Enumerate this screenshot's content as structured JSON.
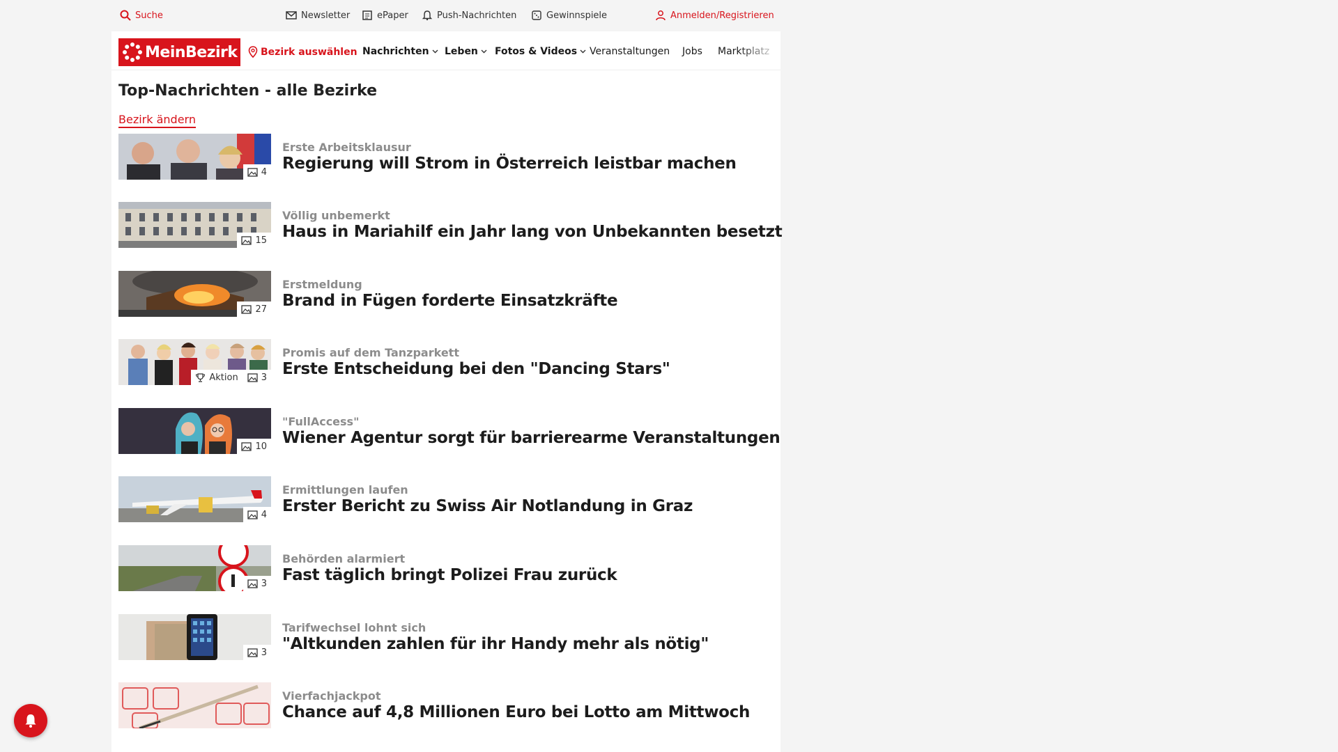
{
  "utility": {
    "search": "Suche",
    "newsletter": "Newsletter",
    "epaper": "ePaper",
    "push": "Push-Nachrichten",
    "contests": "Gewinnspiele",
    "login": "Anmelden/Registrieren"
  },
  "brand": {
    "logo_text": "MeinBezirk",
    "color": "#d8141c"
  },
  "nav": {
    "district": "Bezirk auswählen",
    "items": [
      "Nachrichten",
      "Leben",
      "Fotos & Videos",
      "Veranstaltungen",
      "Jobs",
      "Marktplatz"
    ]
  },
  "main": {
    "heading": "Top-Nachrichten - alle Bezirke",
    "change_district": "Bezirk ändern"
  },
  "articles": [
    {
      "kicker": "Erste Arbeitsklausur",
      "title": "Regierung will Strom in Österreich leistbar machen",
      "photos": "4"
    },
    {
      "kicker": "Völlig unbemerkt",
      "title": "Haus in Mariahilf ein Jahr lang von Unbekannten besetzt",
      "photos": "15"
    },
    {
      "kicker": "Erstmeldung",
      "title": "Brand in Fügen forderte Einsatzkräfte",
      "photos": "27"
    },
    {
      "kicker": "Promis auf dem Tanzparkett",
      "title": "Erste Entscheidung bei den \"Dancing Stars\"",
      "photos": "3",
      "label": "Aktion"
    },
    {
      "kicker": "\"FullAccess\"",
      "title": "Wiener Agentur sorgt für barrierearme Veranstaltungen",
      "photos": "10"
    },
    {
      "kicker": "Ermittlungen laufen",
      "title": "Erster Bericht zu Swiss Air Notlandung in Graz",
      "photos": "4"
    },
    {
      "kicker": "Behörden alarmiert",
      "title": "Fast täglich bringt Polizei Frau zurück",
      "photos": "3"
    },
    {
      "kicker": "Tarifwechsel lohnt sich",
      "title": "\"Altkunden zahlen für ihr Handy mehr als nötig\"",
      "photos": "3"
    },
    {
      "kicker": "Vierfachjackpot",
      "title": "Chance auf 4,8 Millionen Euro bei Lotto am Mittwoch",
      "photos": ""
    }
  ]
}
